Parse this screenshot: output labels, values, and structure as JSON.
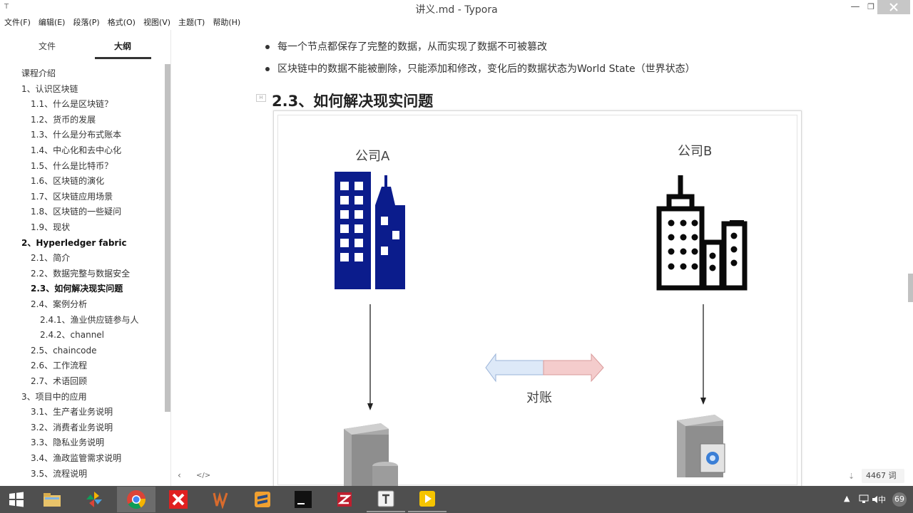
{
  "window": {
    "title": "讲义.md - Typora",
    "app_icon": "T",
    "min_symbol": "—",
    "max_symbol": "❐",
    "close_icon": "close-icon"
  },
  "menu": [
    "文件(F)",
    "编辑(E)",
    "段落(P)",
    "格式(O)",
    "视图(V)",
    "主题(T)",
    "帮助(H)"
  ],
  "sidebar": {
    "tab_files": "文件",
    "tab_outline": "大纲",
    "outline": [
      {
        "label": "课程介绍",
        "level": 1
      },
      {
        "label": "1、认识区块链",
        "level": 1
      },
      {
        "label": "1.1、什么是区块链？",
        "level": 2
      },
      {
        "label": "1.2、货币的发展",
        "level": 2
      },
      {
        "label": "1.3、什么是分布式账本",
        "level": 2
      },
      {
        "label": "1.4、中心化和去中心化",
        "level": 2
      },
      {
        "label": "1.5、什么是比特币？",
        "level": 2
      },
      {
        "label": "1.6、区块链的演化",
        "level": 2
      },
      {
        "label": "1.7、区块链应用场景",
        "level": 2
      },
      {
        "label": "1.8、区块链的一些疑问",
        "level": 2
      },
      {
        "label": "1.9、现状",
        "level": 2
      },
      {
        "label": "2、Hyperledger fabric",
        "level": 1,
        "bold": true
      },
      {
        "label": "2.1、简介",
        "level": 2
      },
      {
        "label": "2.2、数据完整与数据安全",
        "level": 2
      },
      {
        "label": "2.3、如何解决现实问题",
        "level": 2,
        "active": true
      },
      {
        "label": "2.4、案例分析",
        "level": 2
      },
      {
        "label": "2.4.1、渔业供应链参与人",
        "level": 3
      },
      {
        "label": "2.4.2、channel",
        "level": 3
      },
      {
        "label": "2.5、chaincode",
        "level": 2
      },
      {
        "label": "2.6、工作流程",
        "level": 2
      },
      {
        "label": "2.7、术语回顾",
        "level": 2
      },
      {
        "label": "3、项目中的应用",
        "level": 1
      },
      {
        "label": "3.1、生产者业务说明",
        "level": 2
      },
      {
        "label": "3.2、消费者业务说明",
        "level": 2
      },
      {
        "label": "3.3、隐私业务说明",
        "level": 2
      },
      {
        "label": "3.4、渔政监管需求说明",
        "level": 2
      },
      {
        "label": "3.5、流程说明",
        "level": 2
      }
    ]
  },
  "editor": {
    "bullets": [
      "每一个节点都保存了完整的数据，从而实现了数据不可被篡改",
      "区块链中的数据不能被删除，只能添加和修改，变化后的数据状态为World State（世界状态）"
    ],
    "heading": "2.3、如何解决现实问题",
    "figure": {
      "company_a": "公司A",
      "company_b": "公司B",
      "reconcile": "对账",
      "colors": {
        "building_a": "#0b1c8c",
        "building_b": "#0a0a0a",
        "arrow_left": "#dde9f8",
        "arrow_right": "#f4cccc"
      }
    },
    "footer": {
      "back_symbol": "‹",
      "code_symbol": "</>",
      "word_count": "4467 词"
    }
  },
  "taskbar": {
    "items": [
      "start-button",
      "file-explorer",
      "pinwheel-app",
      "chrome",
      "xmind",
      "wps",
      "sublime",
      "intellij",
      "filezilla",
      "typora",
      "player"
    ],
    "tray": {
      "arrow": "▲",
      "ime": "中",
      "clock_badge": "69"
    }
  }
}
